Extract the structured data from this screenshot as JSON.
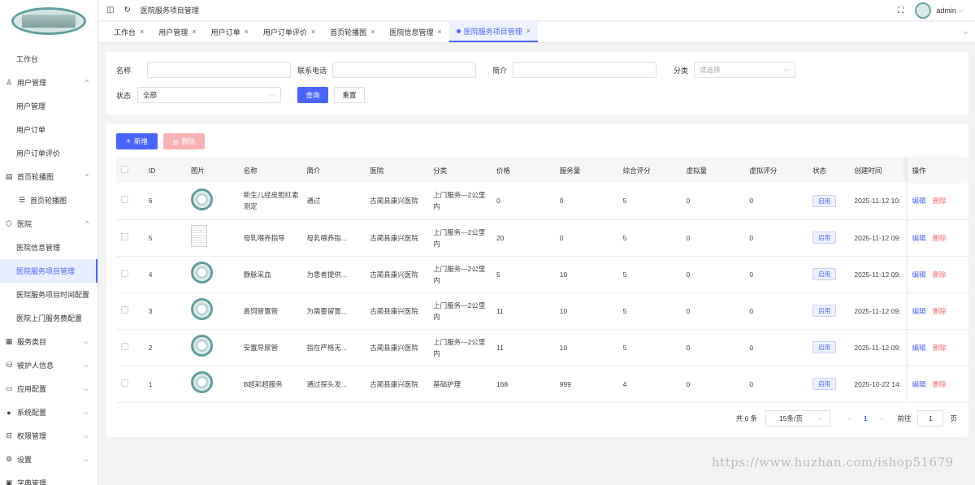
{
  "header": {
    "breadcrumb": "医院服务项目管理",
    "user": "admin"
  },
  "sidebar": {
    "items": [
      {
        "label": "工作台",
        "level": "top",
        "icon": "",
        "arrow": ""
      },
      {
        "label": "用户管理",
        "level": "top",
        "icon": "user-icon",
        "arrow": "^"
      },
      {
        "label": "用户管理",
        "level": "sub",
        "icon": "",
        "arrow": ""
      },
      {
        "label": "用户订单",
        "level": "sub",
        "icon": "",
        "arrow": ""
      },
      {
        "label": "用户订单评价",
        "level": "sub",
        "icon": "",
        "arrow": ""
      },
      {
        "label": "首页轮播图",
        "level": "top",
        "icon": "menu-icon",
        "arrow": "^"
      },
      {
        "label": "首页轮播图",
        "level": "sub2",
        "icon": "list-icon",
        "arrow": ""
      },
      {
        "label": "医院",
        "level": "top",
        "icon": "hospital-icon",
        "arrow": "^"
      },
      {
        "label": "医院信息管理",
        "level": "sub",
        "icon": "",
        "arrow": ""
      },
      {
        "label": "医院服务项目管理",
        "level": "sub",
        "icon": "",
        "arrow": "",
        "active": true
      },
      {
        "label": "医院服务项目时间配置",
        "level": "sub",
        "icon": "",
        "arrow": ""
      },
      {
        "label": "医院上门服务费配置",
        "level": "sub",
        "icon": "",
        "arrow": ""
      },
      {
        "label": "服务类目",
        "level": "top",
        "icon": "calendar-icon",
        "arrow": "v"
      },
      {
        "label": "被护人信息",
        "level": "top",
        "icon": "database-icon",
        "arrow": "v"
      },
      {
        "label": "应用配置",
        "level": "top",
        "icon": "card-icon",
        "arrow": "v"
      },
      {
        "label": "系统配置",
        "level": "top",
        "icon": "check-circle-icon",
        "arrow": "v"
      },
      {
        "label": "权限管理",
        "level": "top",
        "icon": "lock-icon",
        "arrow": "v"
      },
      {
        "label": "设置",
        "level": "top",
        "icon": "gear-icon",
        "arrow": "v"
      },
      {
        "label": "字典管理",
        "level": "top",
        "icon": "book-icon",
        "arrow": ""
      }
    ]
  },
  "tabs": [
    {
      "label": "工作台",
      "active": false
    },
    {
      "label": "用户管理",
      "active": false
    },
    {
      "label": "用户订单",
      "active": false
    },
    {
      "label": "用户订单评价",
      "active": false
    },
    {
      "label": "首页轮播图",
      "active": false
    },
    {
      "label": "医院信息管理",
      "active": false
    },
    {
      "label": "医院服务项目管理",
      "active": true
    }
  ],
  "filters": {
    "name_label": "名称",
    "name_value": "",
    "phone_label": "联系电话",
    "phone_value": "",
    "intro_label": "简介",
    "intro_value": "",
    "category_label": "分类",
    "category_placeholder": "请选择",
    "status_label": "状态",
    "status_value": "全部",
    "query_btn": "查询",
    "reset_btn": "重置"
  },
  "actions": {
    "add_btn": "新增",
    "delete_btn": "删除"
  },
  "table": {
    "headers": [
      "ID",
      "图片",
      "名称",
      "简介",
      "医院",
      "分类",
      "价格",
      "服务量",
      "综合评分",
      "虚拟量",
      "虚拟评分",
      "状态",
      "创建时间",
      "操作"
    ],
    "rows": [
      {
        "id": "6",
        "img": "logo",
        "name": "新生儿经皮胆红素测定",
        "intro": "通过",
        "hospital": "古蔺县康兴医院",
        "category": "上门服务—2公里内",
        "price": "0",
        "volume": "0",
        "score": "5",
        "vvolume": "0",
        "vscore": "0",
        "status": "启用",
        "created": "2025-11-12 10:",
        "edit": "编辑",
        "del": "删除"
      },
      {
        "id": "5",
        "img": "doc",
        "name": "母乳喂养指导",
        "intro": "母乳喂养指...",
        "hospital": "古蔺县康兴医院",
        "category": "上门服务—2公里内",
        "price": "20",
        "volume": "0",
        "score": "5",
        "vvolume": "0",
        "vscore": "0",
        "status": "启用",
        "created": "2025-11-12 09:",
        "edit": "编辑",
        "del": "删除"
      },
      {
        "id": "4",
        "img": "logo",
        "name": "静脉采血",
        "intro": "为患者提供...",
        "hospital": "古蔺县康兴医院",
        "category": "上门服务—2公里内",
        "price": "5",
        "volume": "10",
        "score": "5",
        "vvolume": "0",
        "vscore": "0",
        "status": "启用",
        "created": "2025-11-12 09:",
        "edit": "编辑",
        "del": "删除"
      },
      {
        "id": "3",
        "img": "logo",
        "name": "鼻饲管置管",
        "intro": "为需要留置...",
        "hospital": "古蔺县康兴医院",
        "category": "上门服务—2公里内",
        "price": "11",
        "volume": "10",
        "score": "5",
        "vvolume": "0",
        "vscore": "0",
        "status": "启用",
        "created": "2025-11-12 09:",
        "edit": "编辑",
        "del": "删除"
      },
      {
        "id": "2",
        "img": "logo",
        "name": "安置导尿管",
        "intro": "指在严格无...",
        "hospital": "古蔺县康兴医院",
        "category": "上门服务—2公里内",
        "price": "11",
        "volume": "10",
        "score": "5",
        "vvolume": "0",
        "vscore": "0",
        "status": "启用",
        "created": "2025-11-12 09:",
        "edit": "编辑",
        "del": "删除"
      },
      {
        "id": "1",
        "img": "logo",
        "name": "B超彩超服务",
        "intro": "通过探头发...",
        "hospital": "古蔺县康兴医院",
        "category": "基础护理",
        "price": "168",
        "volume": "999",
        "score": "4",
        "vvolume": "0",
        "vscore": "0",
        "status": "启用",
        "created": "2025-10-22 14:",
        "edit": "编辑",
        "del": "删除"
      }
    ]
  },
  "pagination": {
    "total": "共 6 条",
    "page_size": "15条/页",
    "current": "1",
    "goto_label": "前往",
    "goto_value": "1",
    "page_suffix": "页"
  },
  "watermark": "https://www.huzhan.com/ishop51679",
  "colors": {
    "primary": "#4a65ff",
    "danger": "#f56c6c"
  }
}
